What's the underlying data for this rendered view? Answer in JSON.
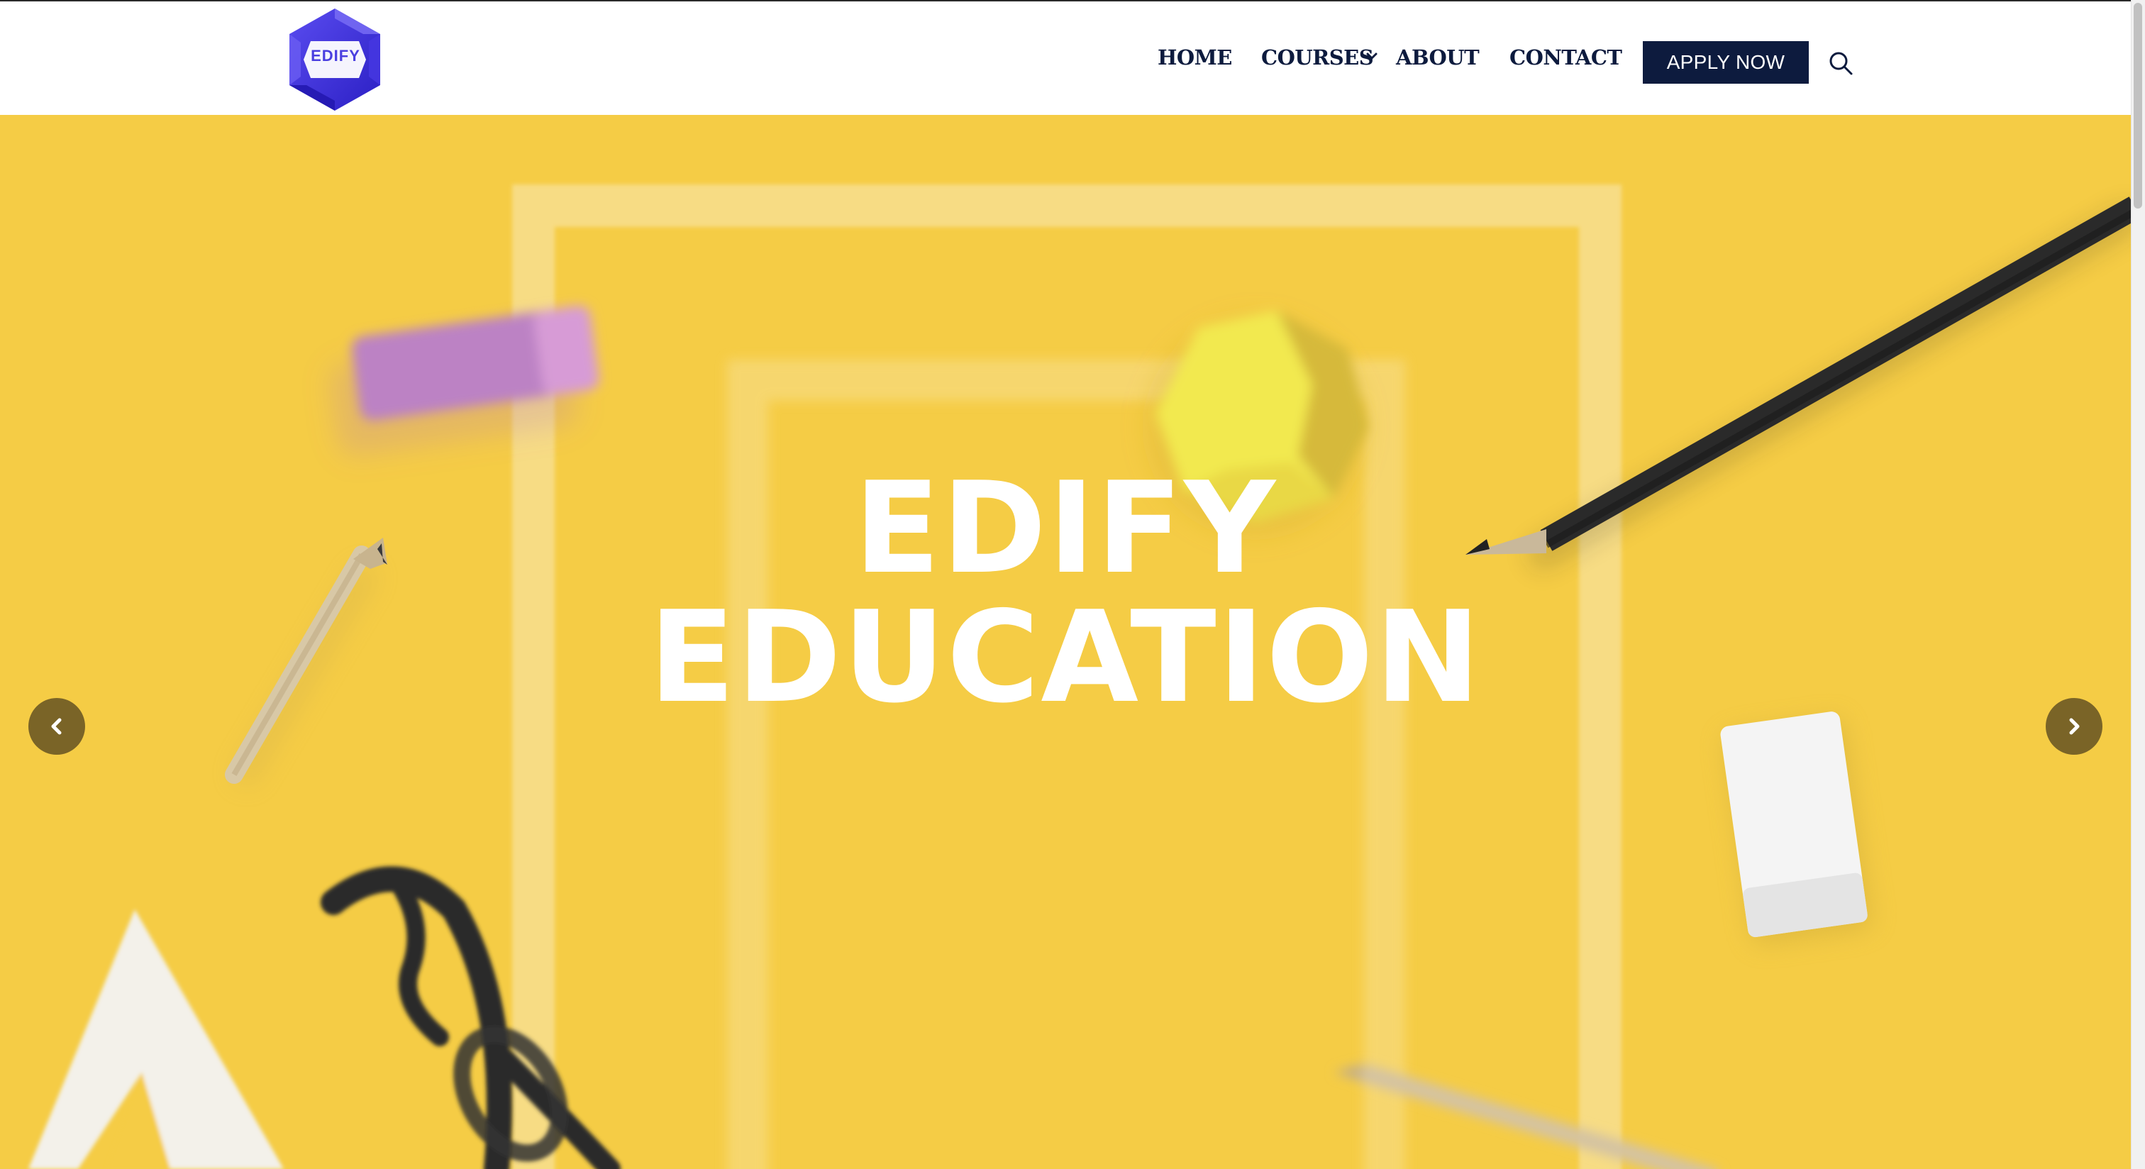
{
  "header": {
    "logo_text": "EDIFY",
    "nav": {
      "home": "HOME",
      "courses": "COURSES",
      "about": "ABOUT",
      "contact": "CONTACT"
    },
    "apply_label": "APPLY NOW"
  },
  "hero": {
    "title_line1": "EDIFY",
    "title_line2": "EDUCATION"
  },
  "icons": {
    "logo": "hexagon-logo-icon",
    "courses_dropdown": "chevron-down-icon",
    "search": "search-icon",
    "prev": "chevron-left-icon",
    "next": "chevron-right-icon"
  },
  "colors": {
    "brand_navy": "#0d1b3e",
    "hero_yellow": "#f5cc45",
    "logo_blue": "#3b2fd6",
    "arrow_bg": "#7a6427"
  }
}
